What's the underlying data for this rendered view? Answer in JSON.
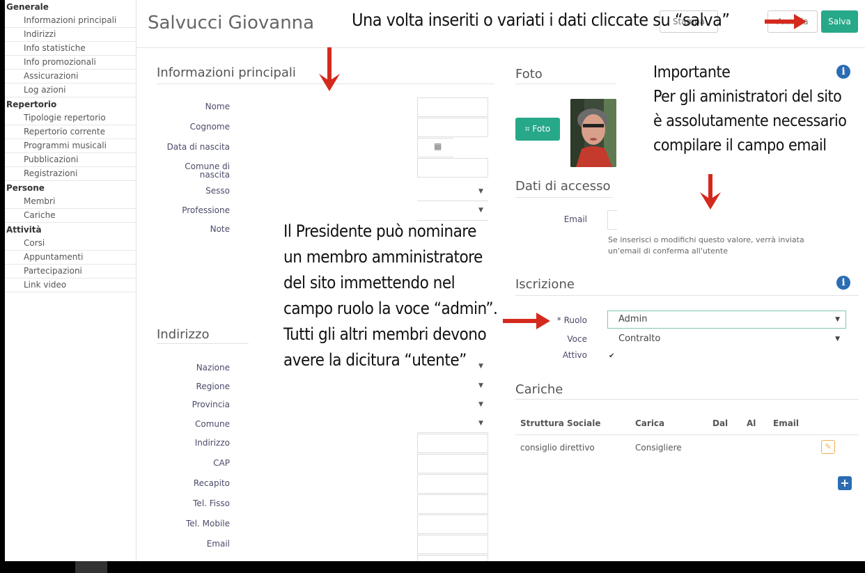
{
  "sidebar": {
    "groups": [
      {
        "title": "Generale",
        "items": [
          "Informazioni principali",
          "Indirizzi",
          "Info statistiche",
          "Info promozionali",
          "Assicurazioni",
          "Log azioni"
        ]
      },
      {
        "title": "Repertorio",
        "items": [
          "Tipologie repertorio",
          "Repertorio corrente",
          "Programmi musicali",
          "Pubblicazioni",
          "Registrazioni"
        ]
      },
      {
        "title": "Persone",
        "items": [
          "Membri",
          "Cariche"
        ]
      },
      {
        "title": "Attività",
        "items": [
          "Corsi",
          "Appuntamenti",
          "Partecipazioni",
          "Link video"
        ]
      }
    ]
  },
  "header": {
    "title": "Salvucci Giovanna",
    "stampa_label": "Stampa",
    "annulla_label": "Annulla",
    "save_label": "Salva"
  },
  "annotations": {
    "save_hint": "Una volta inseriti o variati i dati cliccate su “salva”",
    "admin_hint": [
      "Il Presidente può nominare",
      "un membro amministratore",
      "del sito immettendo nel",
      "campo ruolo la voce “admin”.",
      "Tutti gli altri membri devono",
      "avere la dicitura “utente”"
    ],
    "email_hint": [
      "Importante",
      "Per gli aministratori del sito",
      "è assolutamente necessario",
      "compilare il campo email"
    ]
  },
  "info_principali": {
    "title": "Informazioni principali",
    "fields": [
      "Nome",
      "Cognome",
      "Data di nascita",
      "Comune di nascita",
      "Sesso",
      "Professione",
      "Note"
    ]
  },
  "indirizzo": {
    "title": "Indirizzo",
    "fields": [
      "Nazione",
      "Regione",
      "Provincia",
      "Comune",
      "Indirizzo",
      "CAP",
      "Recapito",
      "Tel. Fisso",
      "Tel. Mobile",
      "Email"
    ]
  },
  "foto": {
    "title": "Foto",
    "button_label": "Foto"
  },
  "accesso": {
    "title": "Dati di accesso",
    "email_label": "Email",
    "email_help": [
      "Se inserisci o modifichi questo valore, verrà inviata",
      "un'email di conferma all'utente"
    ]
  },
  "iscrizione": {
    "title": "Iscrizione",
    "ruolo_label": "* Ruolo",
    "ruolo_value": "Admin",
    "voce_label": "Voce",
    "voce_value": "Contralto",
    "attivo_label": "Attivo"
  },
  "cariche": {
    "title": "Cariche",
    "headers": [
      "Struttura Sociale",
      "Carica",
      "Dal",
      "Al",
      "Email"
    ],
    "rows": [
      [
        "consiglio direttivo",
        "Consigliere",
        "",
        "",
        ""
      ]
    ]
  },
  "colors": {
    "accent": "#26a889",
    "info": "#2b6cb3",
    "arrow": "#d42a1e"
  }
}
